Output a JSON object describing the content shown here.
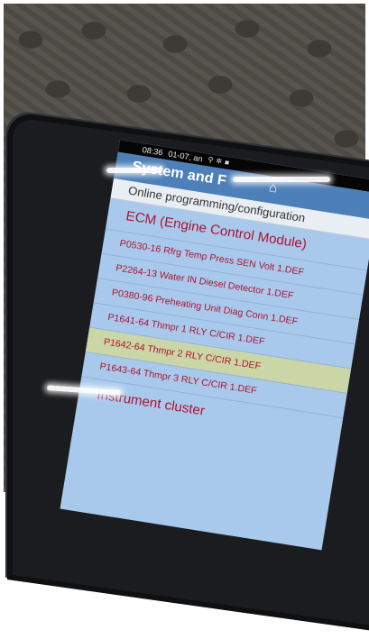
{
  "status_bar": {
    "time": "08:36",
    "date": "01-07, an",
    "icons": [
      "usb-icon",
      "settings-icon",
      "notification-icon"
    ]
  },
  "header": {
    "title": "System and F",
    "home_icon": "home-icon"
  },
  "section": {
    "label": "Online programming/configuration"
  },
  "list": {
    "heading": "ECM (Engine Control Module)",
    "items": [
      {
        "label": "P0530-16 Rfrg Temp Press SEN Volt 1.DEF",
        "selected": false
      },
      {
        "label": "P2264-13 Water IN Diesel Detector 1.DEF",
        "selected": false
      },
      {
        "label": "P0380-96 Preheating Unit Diag Conn 1.DEF",
        "selected": false
      },
      {
        "label": "P1641-64 Thmpr 1 RLY C/CIR 1.DEF",
        "selected": false
      },
      {
        "label": "P1642-64 Thmpr 2 RLY C/CIR 1.DEF",
        "selected": true
      },
      {
        "label": "P1643-64 Thmpr 3 RLY C/CIR 1.DEF",
        "selected": false
      }
    ],
    "footer": "Instrument cluster"
  },
  "colors": {
    "header_bg": "#4d7fb8",
    "list_bg": "#a9c9ec",
    "item_text": "#b0122e",
    "selected_bg": "#cbd6a6"
  }
}
